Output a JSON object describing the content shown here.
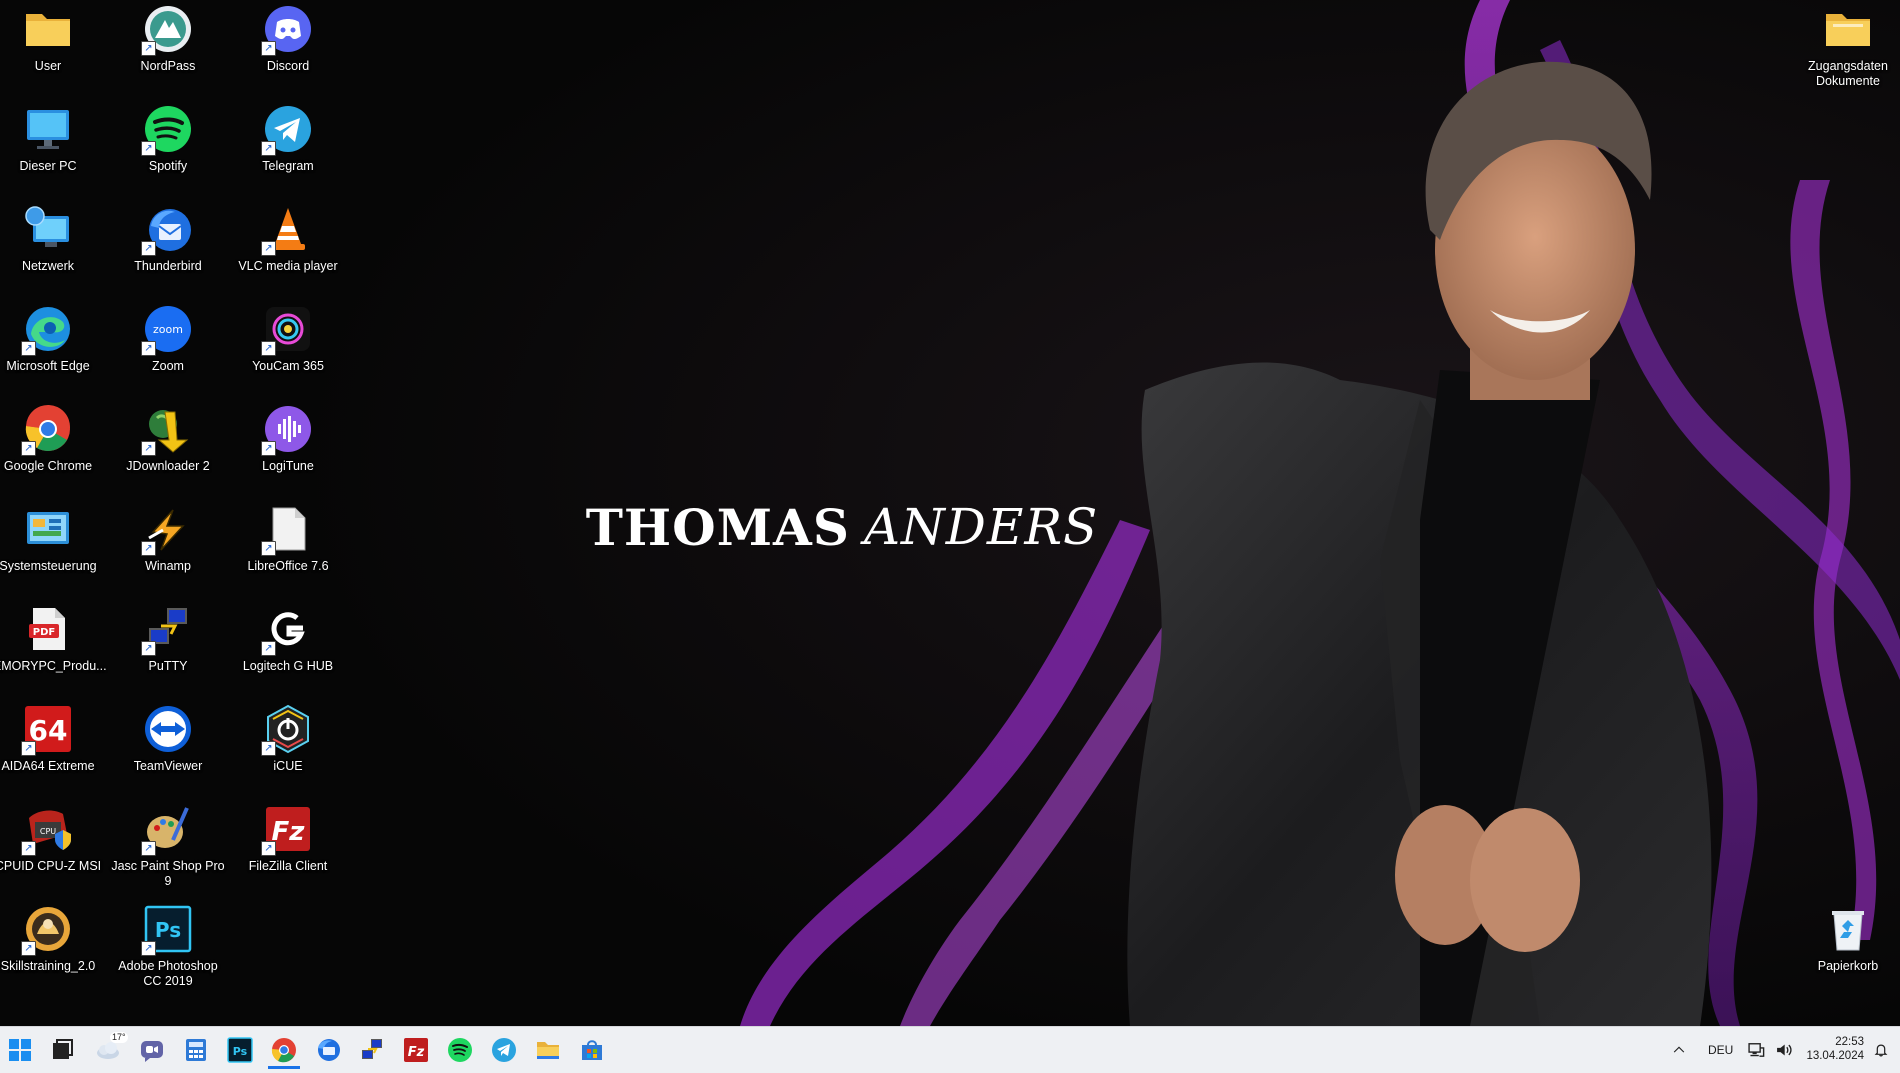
{
  "wallpaper": {
    "title_first": "THOMAS",
    "title_last": "ANDERS",
    "accent_color": "#9a2bd8"
  },
  "desktop_icons": [
    {
      "label": "User",
      "icon": "folder-icon"
    },
    {
      "label": "Dieser PC",
      "icon": "monitor-icon"
    },
    {
      "label": "Netzwerk",
      "icon": "network-icon"
    },
    {
      "label": "Microsoft Edge",
      "icon": "edge-icon"
    },
    {
      "label": "Google Chrome",
      "icon": "chrome-icon"
    },
    {
      "label": "Systemsteuerung",
      "icon": "control-panel-icon"
    },
    {
      "label": "IEMORYPC_Produ...",
      "icon": "pdf-icon"
    },
    {
      "label": "AIDA64 Extreme",
      "icon": "aida64-icon"
    },
    {
      "label": "CPUID CPU-Z MSI",
      "icon": "cpuz-icon"
    },
    {
      "label": "Skillstraining_2.0",
      "icon": "skillstraining-icon"
    },
    {
      "label": "NordPass",
      "icon": "nordpass-icon"
    },
    {
      "label": "Spotify",
      "icon": "spotify-icon"
    },
    {
      "label": "Thunderbird",
      "icon": "thunderbird-icon"
    },
    {
      "label": "Zoom",
      "icon": "zoom-icon"
    },
    {
      "label": "JDownloader 2",
      "icon": "jdownloader-icon"
    },
    {
      "label": "Winamp",
      "icon": "winamp-icon"
    },
    {
      "label": "PuTTY",
      "icon": "putty-icon"
    },
    {
      "label": "TeamViewer",
      "icon": "teamviewer-icon"
    },
    {
      "label": "Jasc Paint Shop Pro 9",
      "icon": "paintshop-icon"
    },
    {
      "label": "Adobe Photoshop CC 2019",
      "icon": "photoshop-icon"
    },
    {
      "label": "Discord",
      "icon": "discord-icon"
    },
    {
      "label": "Telegram",
      "icon": "telegram-icon"
    },
    {
      "label": "VLC media player",
      "icon": "vlc-icon"
    },
    {
      "label": "YouCam 365",
      "icon": "youcam-icon"
    },
    {
      "label": "LogiTune",
      "icon": "logitune-icon"
    },
    {
      "label": "LibreOffice 7.6",
      "icon": "libreoffice-icon"
    },
    {
      "label": "Logitech G HUB",
      "icon": "ghub-icon"
    },
    {
      "label": "iCUE",
      "icon": "icue-icon"
    },
    {
      "label": "FileZilla Client",
      "icon": "filezilla-icon"
    },
    {
      "label": "Zugangsdaten Dokumente",
      "icon": "folder-icon"
    },
    {
      "label": "Papierkorb",
      "icon": "recycle-bin-icon"
    }
  ],
  "taskbar": {
    "weather_temp": "17°",
    "apps": [
      {
        "icon": "start-icon"
      },
      {
        "icon": "task-view-icon"
      },
      {
        "icon": "weather-icon"
      },
      {
        "icon": "teams-chat-icon"
      },
      {
        "icon": "calculator-icon"
      },
      {
        "icon": "photoshop-icon"
      },
      {
        "icon": "chrome-icon"
      },
      {
        "icon": "thunderbird-icon"
      },
      {
        "icon": "putty-icon"
      },
      {
        "icon": "filezilla-icon"
      },
      {
        "icon": "spotify-icon"
      },
      {
        "icon": "telegram-icon"
      },
      {
        "icon": "file-explorer-icon"
      },
      {
        "icon": "store-icon"
      }
    ],
    "tray": {
      "overflow_icon": "chevron-up-icon",
      "language": "DEU",
      "network_icon": "network-icon",
      "volume_icon": "volume-icon",
      "time": "22:53",
      "date": "13.04.2024",
      "notification_icon": "notification-bell-icon"
    }
  }
}
